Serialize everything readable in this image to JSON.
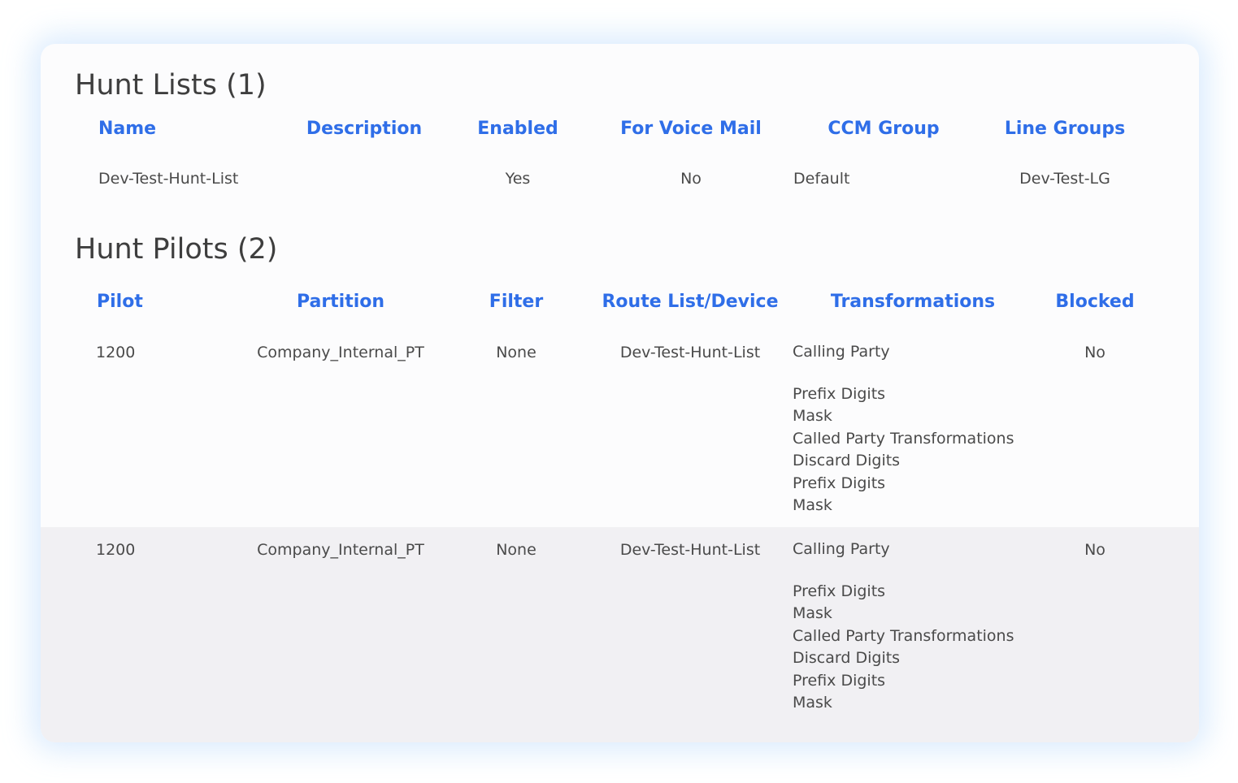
{
  "hunt_lists": {
    "title": "Hunt Lists (1)",
    "columns": [
      "Name",
      "Description",
      "Enabled",
      "For Voice Mail",
      "CCM Group",
      "Line Groups"
    ],
    "rows": [
      {
        "name": "Dev-Test-Hunt-List",
        "description": "",
        "enabled": "Yes",
        "for_voice_mail": "No",
        "ccm_group": "Default",
        "line_groups": "Dev-Test-LG"
      }
    ]
  },
  "hunt_pilots": {
    "title": "Hunt Pilots (2)",
    "columns": [
      "Pilot",
      "Partition",
      "Filter",
      "Route List/Device",
      "Transformations",
      "Blocked"
    ],
    "rows": [
      {
        "pilot": "1200",
        "partition": "Company_Internal_PT",
        "filter": "None",
        "route_list_device": "Dev-Test-Hunt-List",
        "transformations": [
          "Calling Party",
          "Prefix Digits",
          "Mask",
          "Called Party Transformations",
          "Discard Digits",
          "Prefix Digits",
          "Mask"
        ],
        "blocked": "No"
      },
      {
        "pilot": "1200",
        "partition": "Company_Internal_PT",
        "filter": "None",
        "route_list_device": "Dev-Test-Hunt-List",
        "transformations": [
          "Calling Party",
          "Prefix Digits",
          "Mask",
          "Called Party Transformations",
          "Discard Digits",
          "Prefix Digits",
          "Mask"
        ],
        "blocked": "No"
      }
    ]
  },
  "colors": {
    "header_blue": "#2f6ee8",
    "title_gray": "#3e3e3e",
    "text_gray": "#4a4a4a",
    "alt_row_bg": "#f1f0f3",
    "card_bg": "#fcfcfd",
    "card_glow": "#cde4fc"
  }
}
